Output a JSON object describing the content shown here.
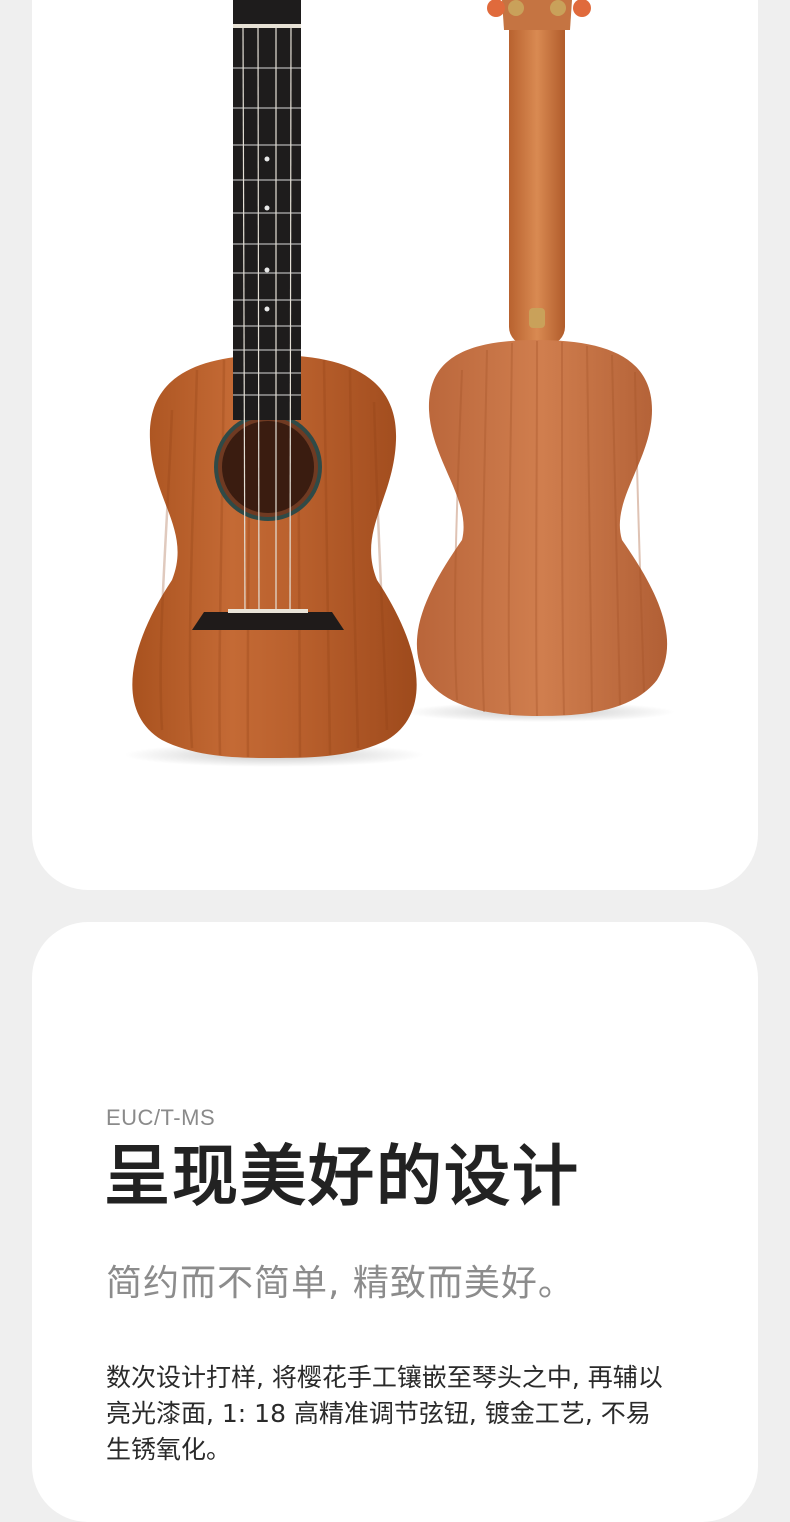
{
  "product": {
    "model": "EUC/T-MS",
    "headline": "呈现美好的设计",
    "subheadline": "简约而不简单, 精致而美好。",
    "description": "数次设计打样, 将樱花手工镶嵌至琴头之中, 再辅以亮光漆面, 1: 18 高精准调节弦钮, 镀金工艺, 不易生锈氧化。"
  },
  "colors": {
    "page_bg": "#efefef",
    "card_bg": "#ffffff",
    "wood": "#b8602e",
    "fretboard": "#1e1c1c"
  },
  "images": {
    "hero": "ukulele-front-and-back-photo"
  }
}
